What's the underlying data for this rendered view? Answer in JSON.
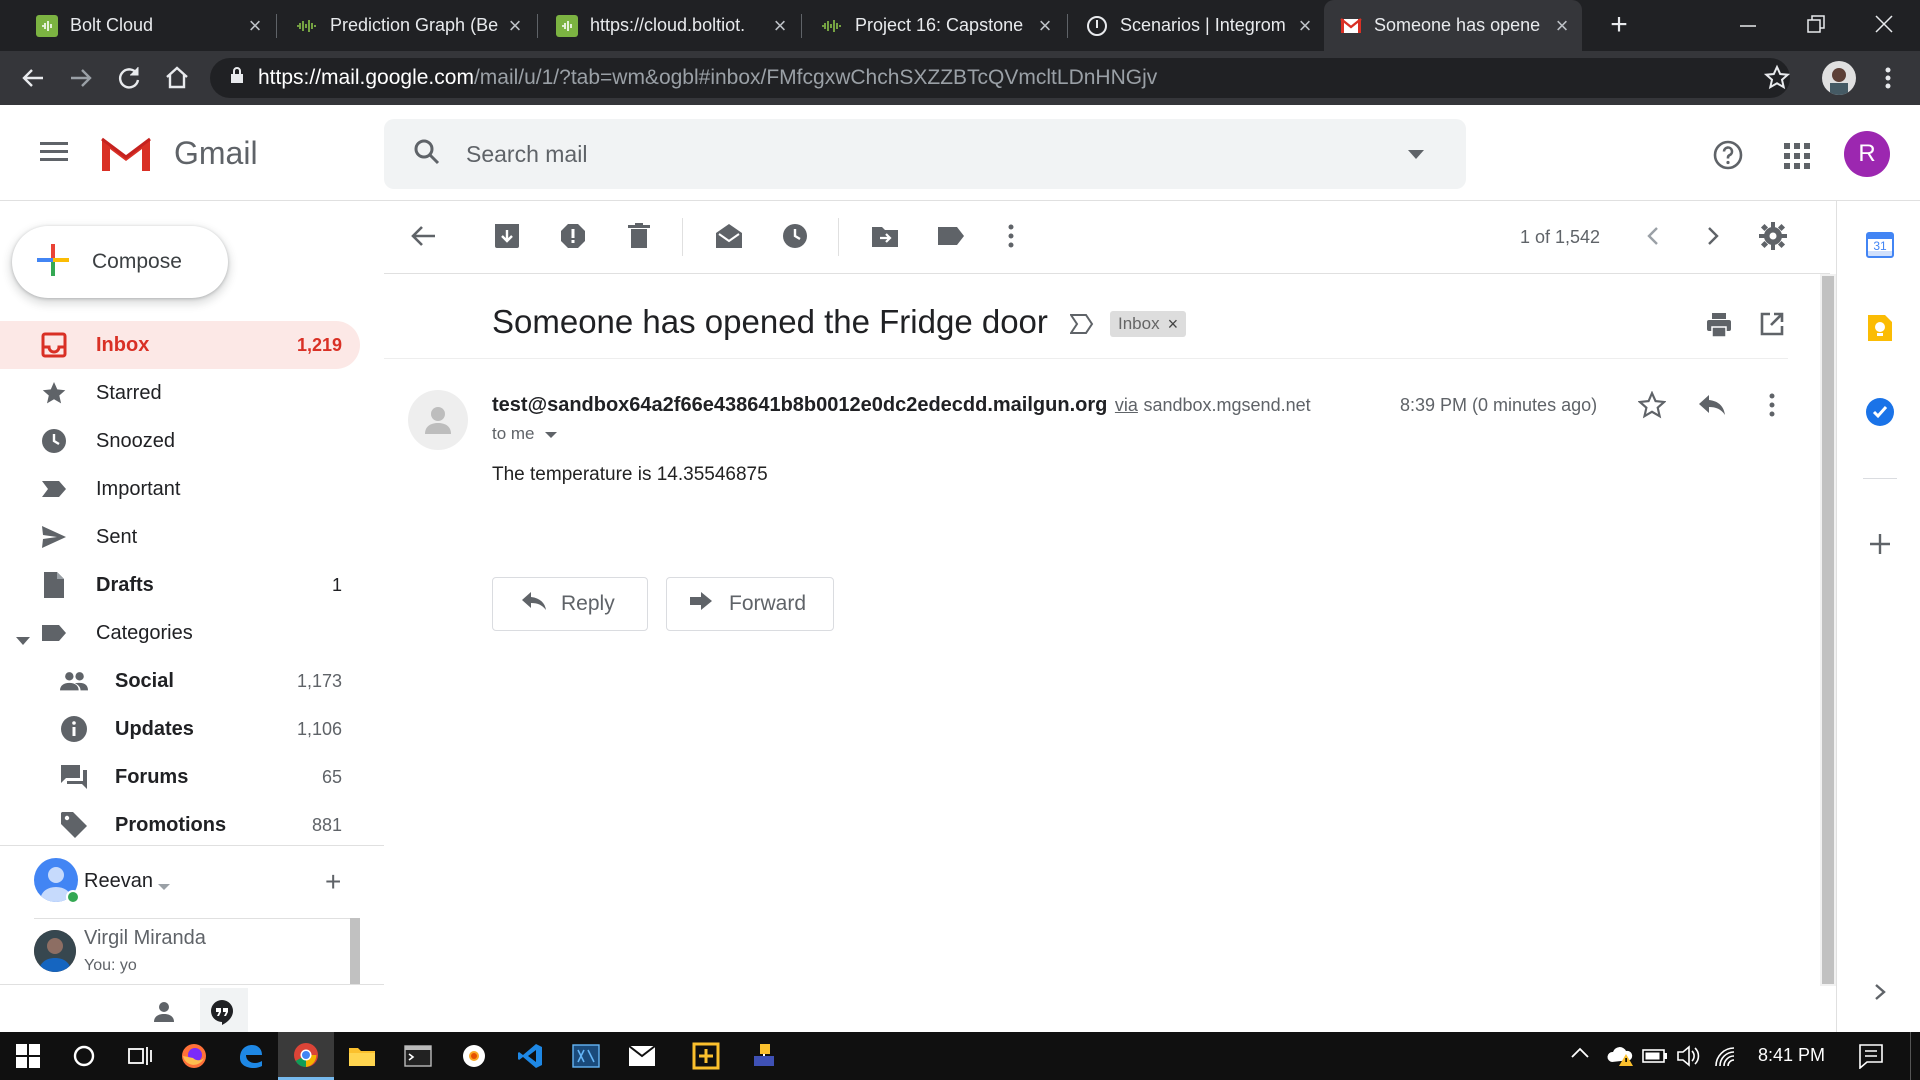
{
  "browser": {
    "tabs": [
      {
        "title": "Bolt Cloud",
        "icon": "boltiot-icon"
      },
      {
        "title": "Prediction Graph (Be",
        "icon": "bolt-wave-icon"
      },
      {
        "title": "https://cloud.boltiot.",
        "icon": "boltiot-icon"
      },
      {
        "title": "Project 16: Capstone",
        "icon": "bolt-wave-icon"
      },
      {
        "title": "Scenarios | Integrom",
        "icon": "integromat-icon"
      },
      {
        "title": "Someone has opene",
        "icon": "gmail-icon"
      }
    ],
    "url_host": "https://mail.google.com",
    "url_rest": "/mail/u/1/?tab=wm&ogbl#inbox/FMfcgxwChchSXZZBTcQVmcltLDnHNGjv"
  },
  "gmail": {
    "logo_text": "Gmail",
    "search_placeholder": "Search mail",
    "avatar_letter": "R",
    "avatar_color": "#9c27b0",
    "compose_label": "Compose",
    "nav": [
      {
        "label": "Inbox",
        "count": "1,219",
        "icon": "inbox-icon"
      },
      {
        "label": "Starred",
        "count": "",
        "icon": "star-icon"
      },
      {
        "label": "Snoozed",
        "count": "",
        "icon": "clock-icon"
      },
      {
        "label": "Important",
        "count": "",
        "icon": "important-icon"
      },
      {
        "label": "Sent",
        "count": "",
        "icon": "send-icon"
      },
      {
        "label": "Drafts",
        "count": "1",
        "icon": "draft-icon"
      },
      {
        "label": "Categories",
        "count": "",
        "icon": "label-icon"
      }
    ],
    "categories": [
      {
        "label": "Social",
        "count": "1,173",
        "icon": "people-icon"
      },
      {
        "label": "Updates",
        "count": "1,106",
        "icon": "info-icon"
      },
      {
        "label": "Forums",
        "count": "65",
        "icon": "forum-icon"
      },
      {
        "label": "Promotions",
        "count": "881",
        "icon": "tag-icon"
      }
    ],
    "hangouts": {
      "user": "Reevan",
      "contact_name": "Virgil Miranda",
      "contact_last": "You: yo"
    },
    "pagination": "1 of 1,542",
    "email": {
      "subject": "Someone has opened the Fridge door",
      "label_chip": "Inbox",
      "sender": "test@sandbox64a2f66e438641b8b0012e0dc2edecdd.mailgun.org",
      "via_label": "via",
      "via_domain": "sandbox.mgsend.net",
      "time": "8:39 PM (0 minutes ago)",
      "to": "to me",
      "body": "The temperature is 14.35546875",
      "reply_label": "Reply",
      "forward_label": "Forward"
    },
    "side_panel": {
      "calendar_date": "31"
    }
  },
  "taskbar": {
    "time": "8:41 PM"
  }
}
